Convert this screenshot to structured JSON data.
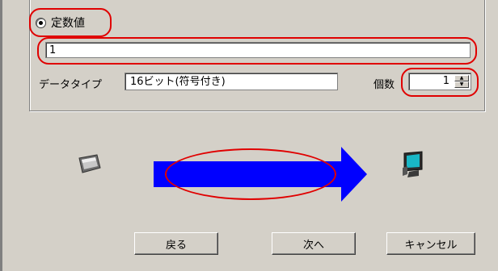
{
  "constant": {
    "radio_label": "定数値",
    "selected": true,
    "value": "1"
  },
  "data_type": {
    "label": "データタイプ",
    "value": "16ビット(符号付き)"
  },
  "count": {
    "label": "個数",
    "value": "1"
  },
  "buttons": {
    "back": "戻る",
    "next": "次へ",
    "cancel": "キャンセル"
  },
  "colors": {
    "highlight": "#e00000",
    "arrow": "#0000ff",
    "background": "#d4d0c8"
  },
  "icons": {
    "source": "display-panel-icon",
    "target": "computer-monitor-icon",
    "transfer": "transfer-arrow"
  }
}
